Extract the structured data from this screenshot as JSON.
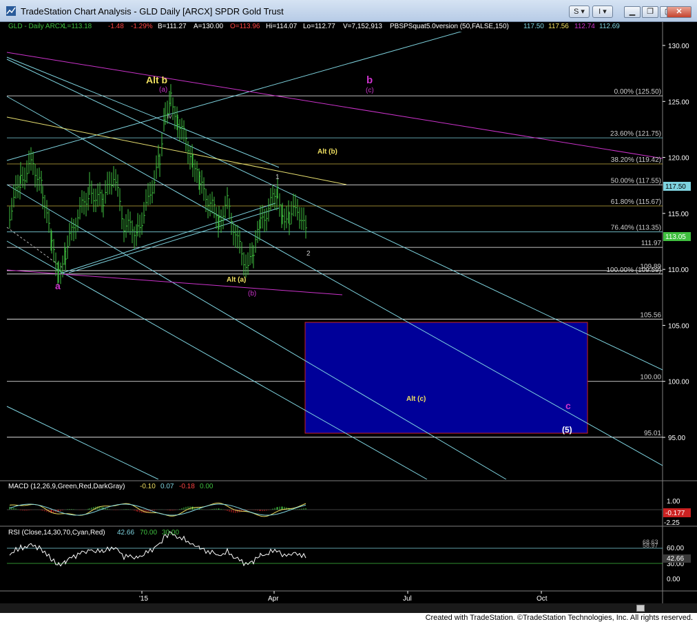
{
  "window": {
    "title": "TradeStation Chart Analysis - GLD Daily [ARCX] SPDR Gold Trust",
    "s_button": "S",
    "i_button": "I"
  },
  "header": {
    "symbol": "GLD - Daily  ARCX",
    "last": "L=113.18",
    "change": "-1.48",
    "pct": "-1.29%",
    "bid": "B=111.27",
    "ask": "A=130.00",
    "open": "O=113.96",
    "high": "Hi=114.07",
    "low": "Lo=112.77",
    "volume": "V=7,152,913",
    "study": "PBSPSquat5.0version (50,FALSE,150)",
    "study_vals": [
      "117.50",
      "117.56",
      "112.74",
      "112.69"
    ]
  },
  "price_axis": {
    "ticks": [
      "130.00",
      "125.00",
      "120.00",
      "115.00",
      "110.00",
      "105.00",
      "100.00",
      "95.00"
    ],
    "current_label": "117.50",
    "price_label": "113.05"
  },
  "fib_labels": [
    {
      "text": "0.00% (125.50)",
      "value": 125.5
    },
    {
      "text": "23.60% (121.75)",
      "value": 121.75
    },
    {
      "text": "38.20% (119.42)",
      "value": 119.42
    },
    {
      "text": "50.00% (117.55)",
      "value": 117.55
    },
    {
      "text": "61.80% (115.67)",
      "value": 115.67
    },
    {
      "text": "76.40% (113.35)",
      "value": 113.35
    },
    {
      "text": "111.97",
      "value": 111.97
    },
    {
      "text": "109.89",
      "value": 109.89
    },
    {
      "text": "100.00% (109.59)",
      "value": 109.59
    },
    {
      "text": "105.56",
      "value": 105.56
    },
    {
      "text": "100.00",
      "value": 100.0
    },
    {
      "text": "95.01",
      "value": 95.01
    }
  ],
  "wave_labels": {
    "alt_b": "Alt b",
    "alt_b_sub": "(a)",
    "iv": "iv",
    "b": "b",
    "b_sub": "(c)",
    "alt_b_paren": "Alt (b)",
    "one": "1",
    "two": "2",
    "alt_a": "Alt (a)",
    "alt_a_sub": "(b)",
    "a": "a",
    "alt_c": "Alt (c)",
    "c": "c",
    "five": "(5)"
  },
  "macd": {
    "label": "MACD (12,26,9,Green,Red,DarkGray)",
    "values": [
      "-0.10",
      "0.07",
      "-0.18",
      "0.00"
    ],
    "axis": [
      "1.00",
      "-2.25"
    ],
    "current": "-0.177"
  },
  "rsi": {
    "label": "RSI (Close,14,30,70,Cyan,Red)",
    "values": [
      "42.66",
      "70.00",
      "30.00"
    ],
    "axis": [
      "60.00",
      "30.00",
      "0.00"
    ],
    "levels": [
      "68.63",
      "58.97"
    ],
    "current": "42.66"
  },
  "time_axis": [
    "'15",
    "Apr",
    "Jul",
    "Oct"
  ],
  "footer": "Created with TradeStation. ©TradeStation Technologies, Inc. All rights reserved.",
  "colors": {
    "bars": "#3fbf3f",
    "cyan": "#7fd4e0",
    "magenta": "#cc33cc",
    "yellow": "#f0e060",
    "target_box": "#000099",
    "target_border": "#cc2222"
  }
}
